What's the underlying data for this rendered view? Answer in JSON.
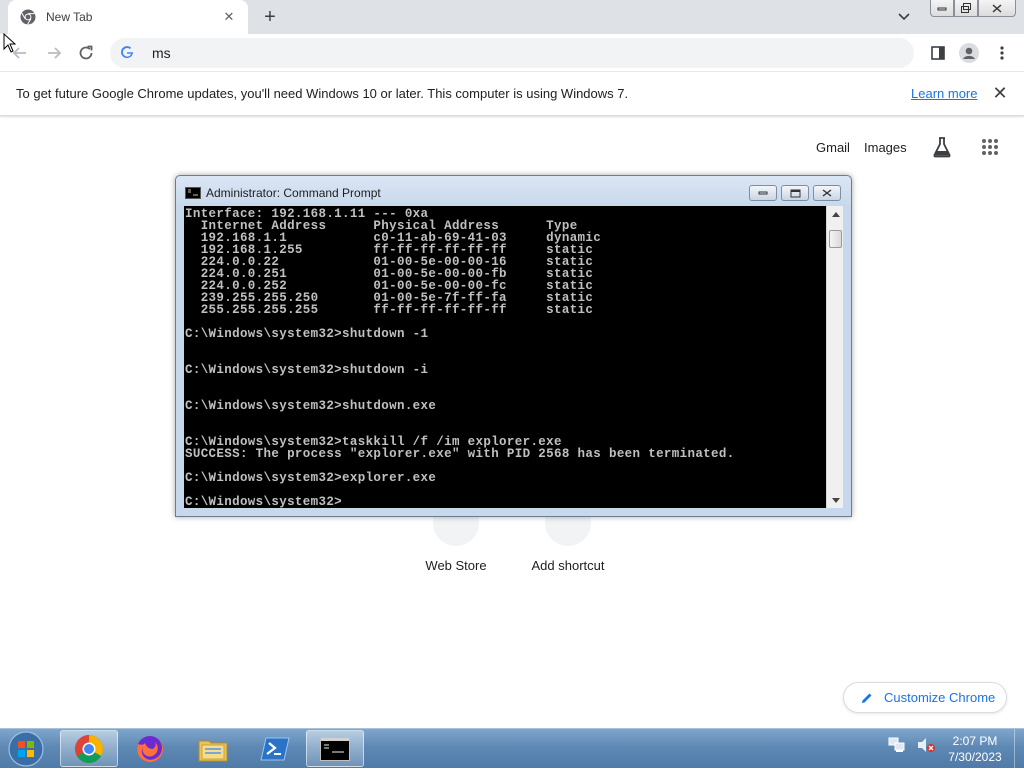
{
  "browser": {
    "tab": {
      "title": "New Tab",
      "close_icon": "close-icon"
    },
    "new_tab_icon": "plus-icon",
    "omnibox": {
      "value": "ms"
    }
  },
  "infobar": {
    "message": "To get future Google Chrome updates, you'll need Windows 10 or later. This computer is using Windows 7.",
    "link": "Learn more"
  },
  "ntp": {
    "gmail": "Gmail",
    "images": "Images",
    "shortcuts": [
      {
        "label": "Web Store"
      },
      {
        "label": "Add shortcut"
      }
    ],
    "customize": "Customize Chrome"
  },
  "cmd": {
    "title": "Administrator:  Command Prompt",
    "lines": [
      "Interface: 192.168.1.11 --- 0xa",
      "  Internet Address      Physical Address      Type",
      "  192.168.1.1           c0-11-ab-69-41-03     dynamic",
      "  192.168.1.255         ff-ff-ff-ff-ff-ff     static",
      "  224.0.0.22            01-00-5e-00-00-16     static",
      "  224.0.0.251           01-00-5e-00-00-fb     static",
      "  224.0.0.252           01-00-5e-00-00-fc     static",
      "  239.255.255.250       01-00-5e-7f-ff-fa     static",
      "  255.255.255.255       ff-ff-ff-ff-ff-ff     static",
      "",
      "C:\\Windows\\system32>shutdown -1",
      "",
      "",
      "C:\\Windows\\system32>shutdown -i",
      "",
      "",
      "C:\\Windows\\system32>shutdown.exe",
      "",
      "",
      "C:\\Windows\\system32>taskkill /f /im explorer.exe",
      "SUCCESS: The process \"explorer.exe\" with PID 2568 has been terminated.",
      "",
      "C:\\Windows\\system32>explorer.exe",
      "",
      "C:\\Windows\\system32>"
    ]
  },
  "taskbar": {
    "items": [
      "chrome-icon",
      "firefox-icon",
      "file-explorer-icon",
      "powershell-icon",
      "command-prompt-icon"
    ],
    "clock": {
      "time": "2:07 PM",
      "date": "7/30/2023"
    }
  },
  "colors": {
    "accent": "#1a73e8",
    "console_bg": "#000000",
    "console_fg": "#c0c0c0",
    "taskbar": "#5f89b5"
  }
}
